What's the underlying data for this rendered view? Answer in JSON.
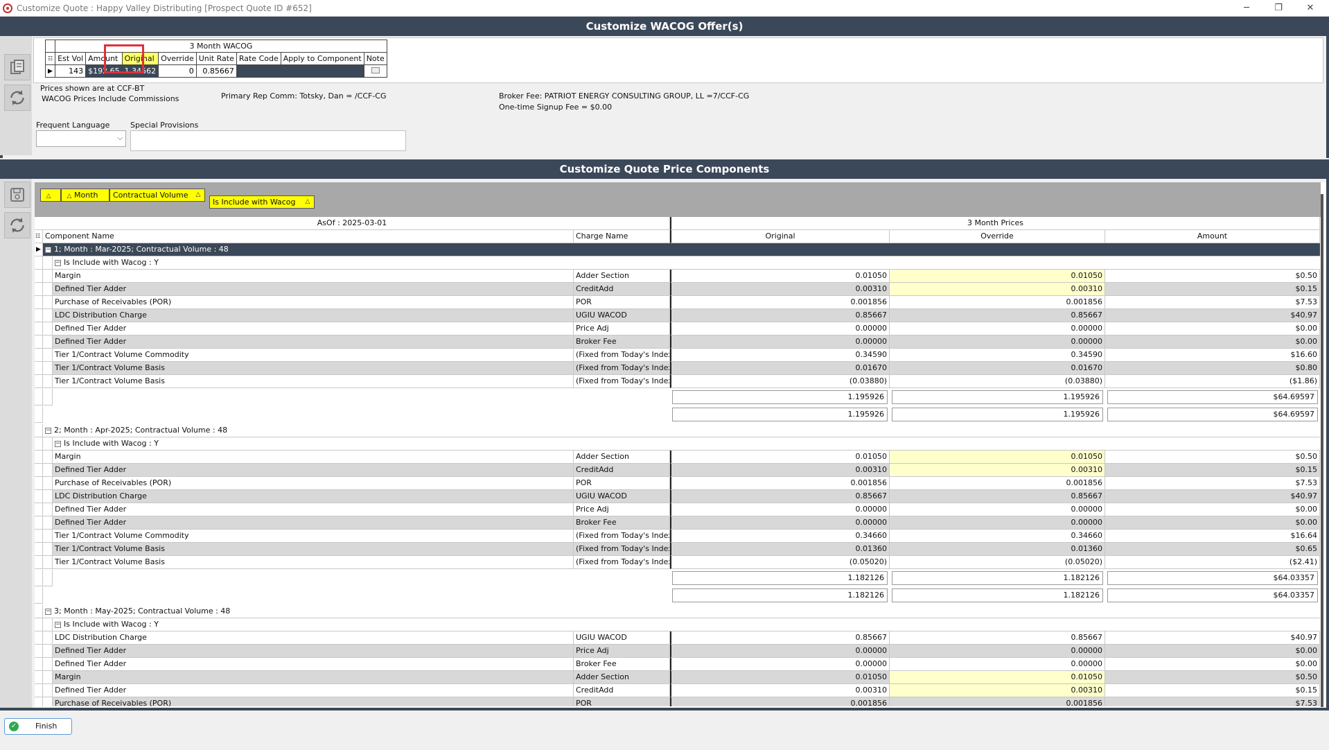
{
  "window": {
    "title": "Customize Quote : Happy Valley Distributing [Prospect Quote ID #652]",
    "min": "─",
    "restore": "❐",
    "close": "✕"
  },
  "wacog": {
    "section_title": "Customize WACOG Offer(s)",
    "table_title": "3 Month WACOG",
    "columns": [
      "Est Vol",
      "Amount",
      "Original",
      "Override",
      "Unit Rate",
      "Rate Code",
      "Apply to Component",
      "Note"
    ],
    "row": {
      "est_vol": "143",
      "amount": "$192.65",
      "original": "1.34562",
      "override": "0",
      "unit_rate": "0.85667",
      "rate_code": "",
      "apply": ""
    },
    "prices_note": "Prices shown are at CCF-BT",
    "include_note": "WACOG Prices Include Commissions",
    "rep_comm": "Primary Rep Comm: Totsky, Dan = /CCF-CG",
    "broker_fee": "Broker Fee: PATRIOT ENERGY CONSULTING GROUP, LL =7/CCF-CG",
    "signup_fee": "One-time Signup Fee = $0.00",
    "frequent_language_label": "Frequent Language",
    "special_provisions_label": "Special Provisions"
  },
  "components": {
    "section_title": "Customize Quote Price Components",
    "group_chips": [
      "Month",
      "Contractual Volume",
      "Is Include with Wacog"
    ],
    "asof": "AsOf : 2025-03-01",
    "prices_header": "3 Month Prices",
    "col_component": "Component Name",
    "col_charge": "Charge Name",
    "col_original": "Original",
    "col_override": "Override",
    "col_amount": "Amount",
    "groups": [
      {
        "label": "1; Month : Mar-2025; Contractual Volume : 48",
        "sub": "Is Include with Wacog : Y",
        "rows": [
          {
            "c": "Margin",
            "ch": "Adder Section",
            "o": "0.01050",
            "ov": "0.01050",
            "a": "$0.50",
            "hl": true
          },
          {
            "c": "Defined Tier Adder",
            "ch": "CreditAdd",
            "o": "0.00310",
            "ov": "0.00310",
            "a": "$0.15",
            "hl": true
          },
          {
            "c": "Purchase of Receivables (POR)",
            "ch": "POR",
            "o": "0.001856",
            "ov": "0.001856",
            "a": "$7.53"
          },
          {
            "c": "LDC Distribution Charge",
            "ch": "UGIU WACOD",
            "o": "0.85667",
            "ov": "0.85667",
            "a": "$40.97"
          },
          {
            "c": "Defined Tier Adder",
            "ch": "Price Adj",
            "o": "0.00000",
            "ov": "0.00000",
            "a": "$0.00"
          },
          {
            "c": "Defined Tier Adder",
            "ch": "Broker Fee",
            "o": "0.00000",
            "ov": "0.00000",
            "a": "$0.00"
          },
          {
            "c": "Tier 1/Contract Volume Commodity",
            "ch": "(Fixed from Today's Index)",
            "o": "0.34590",
            "ov": "0.34590",
            "a": "$16.60"
          },
          {
            "c": "Tier 1/Contract Volume Basis",
            "ch": "(Fixed from Today's Index)",
            "o": "0.01670",
            "ov": "0.01670",
            "a": "$0.80"
          },
          {
            "c": "Tier 1/Contract Volume Basis",
            "ch": "(Fixed from Today's Index)",
            "o": "(0.03880)",
            "ov": "(0.03880)",
            "a": "($1.86)"
          }
        ],
        "sub_total": {
          "o": "1.195926",
          "ov": "1.195926",
          "a": "$64.69597"
        },
        "total": {
          "o": "1.195926",
          "ov": "1.195926",
          "a": "$64.69597"
        }
      },
      {
        "label": "2; Month : Apr-2025; Contractual Volume : 48",
        "sub": "Is Include with Wacog : Y",
        "rows": [
          {
            "c": "Margin",
            "ch": "Adder Section",
            "o": "0.01050",
            "ov": "0.01050",
            "a": "$0.50",
            "hl": true
          },
          {
            "c": "Defined Tier Adder",
            "ch": "CreditAdd",
            "o": "0.00310",
            "ov": "0.00310",
            "a": "$0.15",
            "hl": true
          },
          {
            "c": "Purchase of Receivables (POR)",
            "ch": "POR",
            "o": "0.001856",
            "ov": "0.001856",
            "a": "$7.53"
          },
          {
            "c": "LDC Distribution Charge",
            "ch": "UGIU WACOD",
            "o": "0.85667",
            "ov": "0.85667",
            "a": "$40.97"
          },
          {
            "c": "Defined Tier Adder",
            "ch": "Price Adj",
            "o": "0.00000",
            "ov": "0.00000",
            "a": "$0.00"
          },
          {
            "c": "Defined Tier Adder",
            "ch": "Broker Fee",
            "o": "0.00000",
            "ov": "0.00000",
            "a": "$0.00"
          },
          {
            "c": "Tier 1/Contract Volume Commodity",
            "ch": "(Fixed from Today's Index)",
            "o": "0.34660",
            "ov": "0.34660",
            "a": "$16.64"
          },
          {
            "c": "Tier 1/Contract Volume Basis",
            "ch": "(Fixed from Today's Index)",
            "o": "0.01360",
            "ov": "0.01360",
            "a": "$0.65"
          },
          {
            "c": "Tier 1/Contract Volume Basis",
            "ch": "(Fixed from Today's Index)",
            "o": "(0.05020)",
            "ov": "(0.05020)",
            "a": "($2.41)"
          }
        ],
        "sub_total": {
          "o": "1.182126",
          "ov": "1.182126",
          "a": "$64.03357"
        },
        "total": {
          "o": "1.182126",
          "ov": "1.182126",
          "a": "$64.03357"
        }
      },
      {
        "label": "3; Month : May-2025; Contractual Volume : 48",
        "sub": "Is Include with Wacog : Y",
        "rows": [
          {
            "c": "LDC Distribution Charge",
            "ch": "UGIU WACOD",
            "o": "0.85667",
            "ov": "0.85667",
            "a": "$40.97"
          },
          {
            "c": "Defined Tier Adder",
            "ch": "Price Adj",
            "o": "0.00000",
            "ov": "0.00000",
            "a": "$0.00"
          },
          {
            "c": "Defined Tier Adder",
            "ch": "Broker Fee",
            "o": "0.00000",
            "ov": "0.00000",
            "a": "$0.00"
          },
          {
            "c": "Margin",
            "ch": "Adder Section",
            "o": "0.01050",
            "ov": "0.01050",
            "a": "$0.50",
            "hl": true
          },
          {
            "c": "Defined Tier Adder",
            "ch": "CreditAdd",
            "o": "0.00310",
            "ov": "0.00310",
            "a": "$0.15",
            "hl": true
          },
          {
            "c": "Purchase of Receivables (POR)",
            "ch": "POR",
            "o": "0.001856",
            "ov": "0.001856",
            "a": "$7.53"
          }
        ]
      }
    ]
  },
  "footer": {
    "finish": "Finish"
  },
  "colors": {
    "header_bar": "#3b4859",
    "highlight_yellow": "#ffff00",
    "override_cell": "#ffffcc",
    "selected_original": "#7c8d1e",
    "focus_box": "#e0303a"
  },
  "icons": [
    "copy-icon",
    "refresh-icon",
    "save-icon",
    "refresh-icon",
    "check-icon"
  ]
}
